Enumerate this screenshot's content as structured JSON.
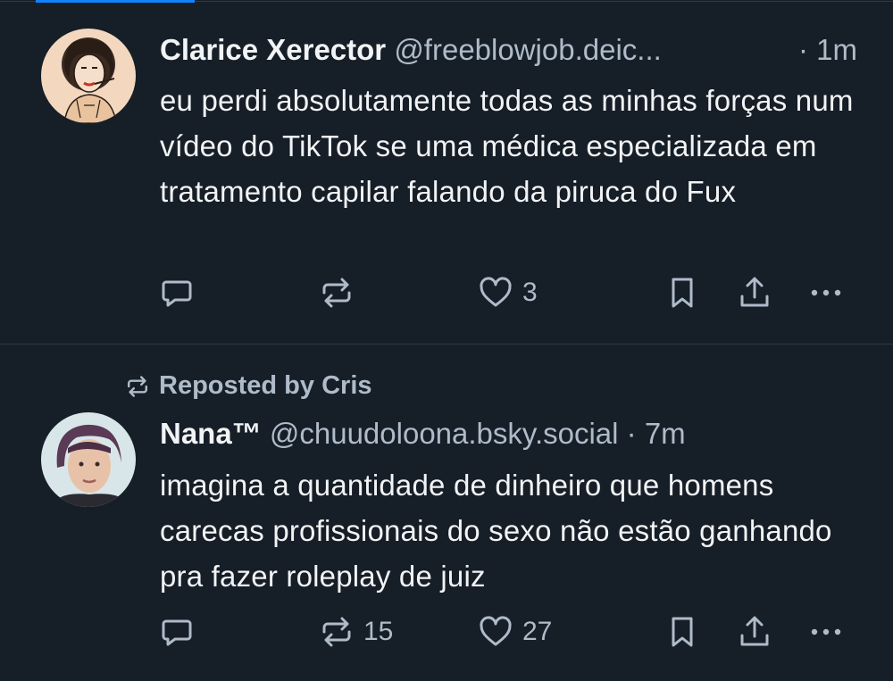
{
  "colors": {
    "background": "#161e27",
    "text": "#f1f3f5",
    "muted": "#aebbc9",
    "divider": "#2e3a48",
    "accent": "#1083fe"
  },
  "posts": [
    {
      "display_name": "Clarice Xerector",
      "handle": "@freeblowjob.deic...",
      "time": "· 1m",
      "text": "eu perdi absolutamente todas as minhas forças num vídeo do TikTok se uma médica especializada em tratamento capilar falando da piruca do Fux",
      "actions": {
        "reply_icon": "chat-bubble-icon",
        "repost_icon": "repost-icon",
        "like_icon": "heart-icon",
        "like_count": "3",
        "bookmark_icon": "bookmark-icon",
        "share_icon": "share-icon",
        "more_icon": "more-icon"
      }
    },
    {
      "reposted_by": "Reposted by Cris",
      "display_name": "Nana™",
      "handle": "@chuudoloona.bsky.social",
      "time": "· 7m",
      "text": "imagina a quantidade de dinheiro que homens carecas profissionais do sexo não estão ganhando pra fazer roleplay de juiz",
      "actions": {
        "reply_icon": "chat-bubble-icon",
        "repost_icon": "repost-icon",
        "repost_count": "15",
        "like_icon": "heart-icon",
        "like_count": "27",
        "bookmark_icon": "bookmark-icon",
        "share_icon": "share-icon",
        "more_icon": "more-icon"
      }
    }
  ]
}
